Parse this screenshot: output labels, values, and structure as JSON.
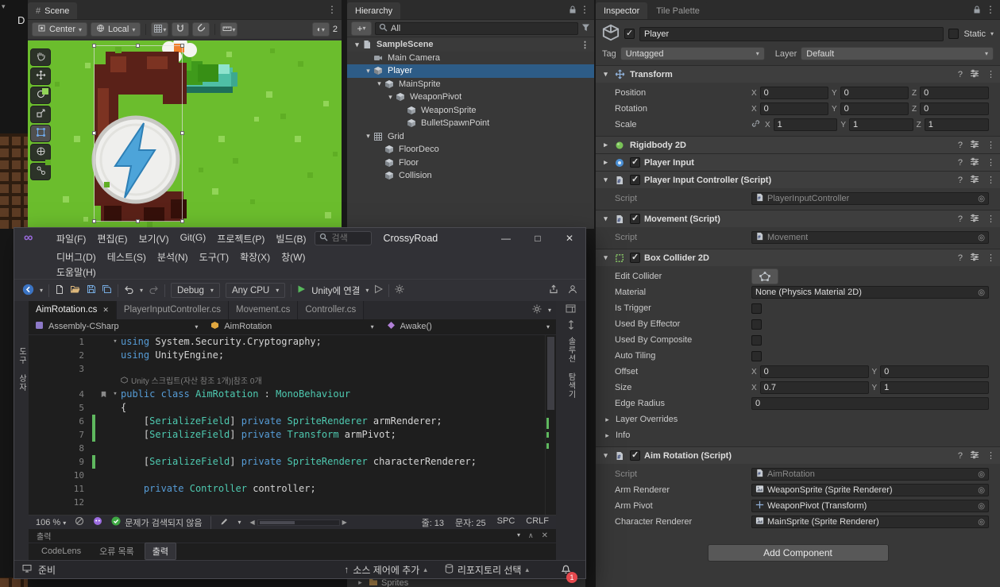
{
  "unity": {
    "left_strip": {
      "letter": "D"
    },
    "scene": {
      "tab_label": "Scene",
      "toolbar": {
        "center_label": "Center",
        "local_label": "Local",
        "overlay_number": "2"
      },
      "tools": [
        {
          "icon": "hand-tool-icon",
          "selected": false
        },
        {
          "icon": "move-tool-icon",
          "selected": false
        },
        {
          "icon": "rotate-tool-icon",
          "selected": false
        },
        {
          "icon": "scale-tool-icon",
          "selected": false
        },
        {
          "icon": "rect-tool-icon",
          "selected": true
        },
        {
          "icon": "transform-tool-icon",
          "selected": false
        },
        {
          "icon": "custom-tool-icon",
          "selected": false
        }
      ],
      "grass": [
        [
          18,
          60,
          8,
          0
        ],
        [
          34,
          52,
          6,
          1
        ],
        [
          72,
          28,
          7,
          0
        ],
        [
          110,
          8,
          8,
          1
        ],
        [
          58,
          120,
          8,
          0
        ],
        [
          22,
          150,
          7,
          1
        ],
        [
          44,
          196,
          8,
          0
        ],
        [
          96,
          178,
          7,
          1
        ],
        [
          70,
          222,
          6,
          0
        ],
        [
          150,
          228,
          7,
          1
        ],
        [
          240,
          120,
          8,
          0
        ],
        [
          258,
          148,
          7,
          1
        ],
        [
          232,
          186,
          8,
          0
        ],
        [
          280,
          200,
          6,
          1
        ],
        [
          300,
          64,
          8,
          0
        ],
        [
          318,
          92,
          7,
          1
        ],
        [
          336,
          120,
          8,
          0
        ],
        [
          352,
          166,
          7,
          1
        ],
        [
          372,
          76,
          7,
          0
        ],
        [
          384,
          140,
          6,
          1
        ],
        [
          340,
          26,
          7,
          1
        ],
        [
          374,
          216,
          8,
          0
        ],
        [
          250,
          14,
          7,
          0
        ],
        [
          305,
          10,
          6,
          1
        ],
        [
          285,
          96,
          6,
          0
        ],
        [
          215,
          160,
          6,
          1
        ]
      ]
    },
    "hierarchy": {
      "tab_label": "Hierarchy",
      "search_value": "All",
      "items": [
        {
          "label": "SampleScene",
          "level": 0,
          "icon": "scene-icon",
          "fold": "open",
          "scene": true,
          "menu": true
        },
        {
          "label": "Main Camera",
          "level": 1,
          "icon": "camera-icon",
          "fold": "none"
        },
        {
          "label": "Player",
          "level": 1,
          "icon": "cube-icon",
          "fold": "open",
          "selected": true
        },
        {
          "label": "MainSprite",
          "level": 2,
          "icon": "cube-icon",
          "fold": "open"
        },
        {
          "label": "WeaponPivot",
          "level": 3,
          "icon": "cube-icon",
          "fold": "open"
        },
        {
          "label": "WeaponSprite",
          "level": 4,
          "icon": "cube-icon",
          "fold": "none"
        },
        {
          "label": "BulletSpawnPoint",
          "level": 4,
          "icon": "cube-icon",
          "fold": "none"
        },
        {
          "label": "Grid",
          "level": 1,
          "icon": "grid-icon",
          "fold": "open"
        },
        {
          "label": "FloorDeco",
          "level": 2,
          "icon": "cube-icon",
          "fold": "none"
        },
        {
          "label": "Floor",
          "level": 2,
          "icon": "cube-icon",
          "fold": "none"
        },
        {
          "label": "Collision",
          "level": 2,
          "icon": "cube-icon",
          "fold": "none"
        }
      ]
    },
    "project_row": {
      "label": "Sprites"
    },
    "inspector": {
      "tabs": [
        {
          "label": "Inspector"
        },
        {
          "label": "Tile Palette"
        }
      ],
      "gameobject": {
        "name": "Player",
        "static_label": "Static",
        "tag_label": "Tag",
        "tag_value": "Untagged",
        "layer_label": "Layer",
        "layer_value": "Default"
      },
      "components": [
        {
          "title": "Transform",
          "icon": "transform-icon",
          "fold": "open",
          "checkbox": false,
          "rows": [
            {
              "type": "vec",
              "label": "Position",
              "fields": [
                [
                  "X",
                  "0"
                ],
                [
                  "Y",
                  "0"
                ],
                [
                  "Z",
                  "0"
                ]
              ]
            },
            {
              "type": "vec",
              "label": "Rotation",
              "fields": [
                [
                  "X",
                  "0"
                ],
                [
                  "Y",
                  "0"
                ],
                [
                  "Z",
                  "0"
                ]
              ]
            },
            {
              "type": "vec",
              "label": "Scale",
              "link": true,
              "fields": [
                [
                  "X",
                  "1"
                ],
                [
                  "Y",
                  "1"
                ],
                [
                  "Z",
                  "1"
                ]
              ]
            }
          ]
        },
        {
          "title": "Rigidbody 2D",
          "icon": "rigidbody-icon",
          "fold": "closed",
          "checkbox": false,
          "rows": []
        },
        {
          "title": "Player Input",
          "icon": "playerinput-icon",
          "fold": "closed",
          "checkbox": true,
          "rows": []
        },
        {
          "title": "Player Input Controller (Script)",
          "icon": "script-icon",
          "fold": "open",
          "checkbox": true,
          "rows": [
            {
              "type": "object",
              "label": "Script",
              "value": "PlayerInputController",
              "icon": "script-mini-icon",
              "disabled": true
            }
          ]
        },
        {
          "title": "Movement (Script)",
          "icon": "script-icon",
          "fold": "open",
          "checkbox": true,
          "rows": [
            {
              "type": "object",
              "label": "Script",
              "value": "Movement",
              "icon": "script-mini-icon",
              "disabled": true
            }
          ]
        },
        {
          "title": "Box Collider 2D",
          "icon": "collider-icon",
          "fold": "open",
          "checkbox": true,
          "rows": [
            {
              "type": "button",
              "label": "Edit Collider",
              "icon": "collider-edit-icon"
            },
            {
              "type": "object",
              "label": "Material",
              "value": "None (Physics Material 2D)",
              "icon": null,
              "disabled": false
            },
            {
              "type": "check",
              "label": "Is Trigger",
              "checked": false
            },
            {
              "type": "check",
              "label": "Used By Effector",
              "checked": false
            },
            {
              "type": "check",
              "label": "Used By Composite",
              "checked": false
            },
            {
              "type": "check",
              "label": "Auto Tiling",
              "checked": false
            },
            {
              "type": "vec",
              "label": "Offset",
              "fields": [
                [
                  "X",
                  "0"
                ],
                [
                  "Y",
                  "0"
                ]
              ]
            },
            {
              "type": "vec",
              "label": "Size",
              "fields": [
                [
                  "X",
                  "0.7"
                ],
                [
                  "Y",
                  "1"
                ]
              ]
            },
            {
              "type": "single",
              "label": "Edge Radius",
              "value": "0"
            },
            {
              "type": "fold",
              "label": "Layer Overrides"
            },
            {
              "type": "fold",
              "label": "Info"
            }
          ]
        },
        {
          "title": "Aim Rotation (Script)",
          "icon": "script-icon",
          "fold": "open",
          "checkbox": true,
          "rows": [
            {
              "type": "object",
              "label": "Script",
              "value": "AimRotation",
              "icon": "script-mini-icon",
              "disabled": true
            },
            {
              "type": "object",
              "label": "Arm Renderer",
              "value": "WeaponSprite (Sprite Renderer)",
              "icon": "sprite-mini-icon",
              "disabled": false
            },
            {
              "type": "object",
              "label": "Arm Pivot",
              "value": "WeaponPivot (Transform)",
              "icon": "transform-mini-icon",
              "disabled": false
            },
            {
              "type": "object",
              "label": "Character Renderer",
              "value": "MainSprite (Sprite Renderer)",
              "icon": "sprite-mini-icon",
              "disabled": false
            }
          ]
        }
      ],
      "add_component_label": "Add Component"
    }
  },
  "vs": {
    "title": "CrossyRoad",
    "search_placeholder": "검색",
    "menus_row1": [
      "파일(F)",
      "편집(E)",
      "보기(V)",
      "Git(G)",
      "프로젝트(P)",
      "빌드(B)"
    ],
    "menus_row2": [
      "디버그(D)",
      "테스트(S)",
      "분석(N)",
      "도구(T)",
      "확장(X)",
      "창(W)"
    ],
    "menus_row3": [
      "도움말(H)"
    ],
    "toolbar": {
      "config": "Debug",
      "platform": "Any CPU",
      "run_label": "Unity에 연결"
    },
    "left_tab": "도구 상자",
    "right_tab": "솔루션 탐색기",
    "tabs": [
      {
        "label": "AimRotation.cs",
        "active": true
      },
      {
        "label": "PlayerInputController.cs",
        "active": false
      },
      {
        "label": "Movement.cs",
        "active": false
      },
      {
        "label": "Controller.cs",
        "active": false
      }
    ],
    "breadcrumb": [
      {
        "label": "Assembly-CSharp",
        "icon": "assembly-icon"
      },
      {
        "label": "AimRotation",
        "icon": "class-icon"
      },
      {
        "label": "Awake()",
        "icon": "method-icon"
      }
    ],
    "editor_lines": [
      {
        "n": "1",
        "fold": true,
        "segs": [
          [
            "k",
            "using"
          ],
          [
            "p",
            " System.Security.Cryptography;"
          ]
        ]
      },
      {
        "n": "2",
        "segs": [
          [
            "k",
            "using"
          ],
          [
            "p",
            " UnityEngine;"
          ]
        ]
      },
      {
        "n": "3",
        "segs": []
      },
      {
        "lens": true,
        "text": "Unity 스크립트(자산 참조 1개)|참조 0개"
      },
      {
        "n": "4",
        "fold": true,
        "gicon": true,
        "segs": [
          [
            "k",
            "public"
          ],
          [
            "p",
            " "
          ],
          [
            "k",
            "class"
          ],
          [
            "p",
            " "
          ],
          [
            "t",
            "AimRotation"
          ],
          [
            "p",
            " : "
          ],
          [
            "t",
            "MonoBehaviour"
          ]
        ]
      },
      {
        "n": "5",
        "segs": [
          [
            "p",
            "{"
          ]
        ]
      },
      {
        "n": "6",
        "chg": true,
        "segs": [
          [
            "p",
            "    ["
          ],
          [
            "t",
            "SerializeField"
          ],
          [
            "p",
            "] "
          ],
          [
            "k",
            "private"
          ],
          [
            "p",
            " "
          ],
          [
            "t",
            "SpriteRenderer"
          ],
          [
            "p",
            " armRenderer;"
          ]
        ]
      },
      {
        "n": "7",
        "chg": true,
        "segs": [
          [
            "p",
            "    ["
          ],
          [
            "t",
            "SerializeField"
          ],
          [
            "p",
            "] "
          ],
          [
            "k",
            "private"
          ],
          [
            "p",
            " "
          ],
          [
            "t",
            "Transform"
          ],
          [
            "p",
            " armPivot;"
          ]
        ]
      },
      {
        "n": "8",
        "segs": []
      },
      {
        "n": "9",
        "chg": true,
        "segs": [
          [
            "p",
            "    ["
          ],
          [
            "t",
            "SerializeField"
          ],
          [
            "p",
            "] "
          ],
          [
            "k",
            "private"
          ],
          [
            "p",
            " "
          ],
          [
            "t",
            "SpriteRenderer"
          ],
          [
            "p",
            " characterRenderer;"
          ]
        ]
      },
      {
        "n": "10",
        "segs": []
      },
      {
        "n": "11",
        "segs": [
          [
            "p",
            "    "
          ],
          [
            "k",
            "private"
          ],
          [
            "p",
            " "
          ],
          [
            "t",
            "Controller"
          ],
          [
            "p",
            " controller;"
          ]
        ]
      },
      {
        "n": "12",
        "segs": []
      }
    ],
    "status": {
      "zoom": "106 %",
      "message": "문제가 검색되지 않음",
      "line": "줄: 13",
      "col": "문자: 25",
      "spc": "SPC",
      "eol": "CRLF"
    },
    "output": {
      "title": "출력",
      "tabs": [
        {
          "label": "CodeLens",
          "active": false
        },
        {
          "label": "오류 목록",
          "active": false
        },
        {
          "label": "출력",
          "active": true
        }
      ]
    },
    "statusbar": {
      "ready": "준비",
      "add_source_control": "소스 제어에 추가",
      "select_repo": "리포지토리 선택",
      "notifications": "1"
    }
  }
}
